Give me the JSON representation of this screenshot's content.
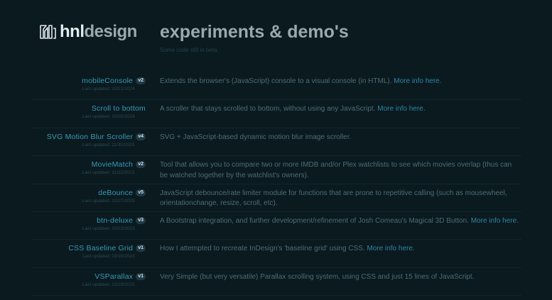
{
  "header": {
    "logo_hnl": "hnl",
    "logo_design": "design",
    "title": "experiments & demo's",
    "subtitle": "Some code still in beta."
  },
  "updated_prefix": "Last updated: ",
  "projects": [
    {
      "name": "mobileConsole",
      "version": "v2",
      "updated": "10/21/2024",
      "description": "Extends the browser's (JavaScript) console to a visual console (in HTML).",
      "more": "More info here."
    },
    {
      "name": "Scroll to bottom",
      "version": "",
      "updated": "10/20/2024",
      "description": "A scroller that stays scrolled to bottom, without using any JavaScript.",
      "more": "More info here."
    },
    {
      "name": "SVG Motion Blur Scroller",
      "version": "v4",
      "updated": "11/30/2023",
      "description": "SVG + JavaScript-based dynamic motion blur image scroller.",
      "more": ""
    },
    {
      "name": "MovieMatch",
      "version": "v2",
      "updated": "11/22/2023",
      "description": "Tool that allows you to compare two or more IMDB and/or Plex watchlists to see which movies overlap (thus can be watched together by the watchlist's owners).",
      "more": ""
    },
    {
      "name": "deBounce",
      "version": "v5",
      "updated": "10/27/2023",
      "description": "JavaScript debounce/rate limiter module for functions that are prone to repetitive calling (such as mousewheel, orientationchange, resize, scroll, etc).",
      "more": ""
    },
    {
      "name": "btn-deluxe",
      "version": "v3",
      "updated": "10/22/2023",
      "description": "A Bootstrap integration, and further development/refinement of Josh Comeau's Magical 3D Button.",
      "more": "More info here."
    },
    {
      "name": "CSS Baseline Grid",
      "version": "v1",
      "updated": "03/15/2023",
      "description": "How I attempted to recreate InDesign's 'baseline grid' using CSS.",
      "more": "More info here."
    },
    {
      "name": "VSParallax",
      "version": "v1",
      "updated": "12/29/2021",
      "description": "Very Simple (but very versatile) Parallax scrolling system, using CSS and just 15 lines of JavaScript.",
      "more": ""
    }
  ]
}
